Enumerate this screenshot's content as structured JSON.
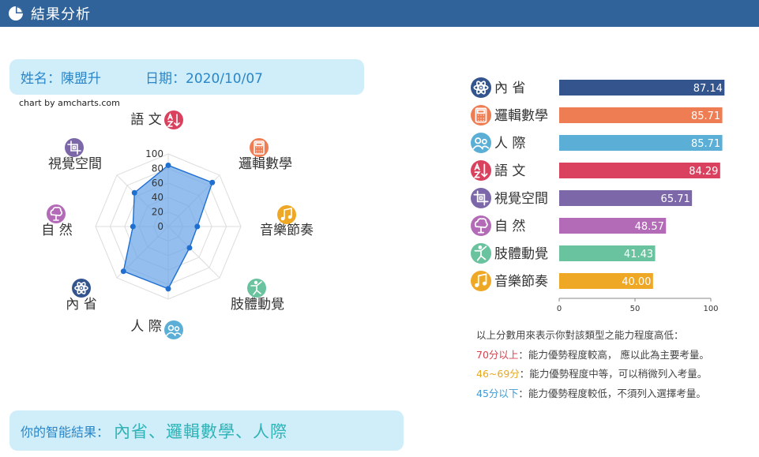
{
  "header": {
    "title": "結果分析"
  },
  "info": {
    "name": "姓名：陳盟升",
    "date": "日期：2020/10/07"
  },
  "credit": "chart by amcharts.com",
  "chart_data": [
    {
      "type": "radar",
      "axes": [
        "語 文",
        "邏輯數學",
        "音樂節奏",
        "肢體動覺",
        "人 際",
        "內 省",
        "自 然",
        "視覺空間"
      ],
      "icons": [
        "az-icon",
        "calculator-icon",
        "music-icon",
        "dance-icon",
        "people-icon",
        "atom-icon",
        "tree-icon",
        "crop-icon"
      ],
      "icon_colors": [
        "#d9415e",
        "#ef7d53",
        "#efa825",
        "#68c39e",
        "#5bafd7",
        "#33548d",
        "#b46bb7",
        "#7c67a9"
      ],
      "values": [
        84.29,
        85.71,
        40.0,
        41.43,
        85.71,
        87.14,
        48.57,
        65.71
      ],
      "ticks": [
        "0",
        "20",
        "40",
        "60",
        "80",
        "100"
      ],
      "range": [
        0,
        100
      ],
      "fill": "#6aa5e8",
      "stroke": "#1f6fd1"
    },
    {
      "type": "bar",
      "orientation": "horizontal",
      "categories": [
        "內 省",
        "邏輯數學",
        "人 際",
        "語 文",
        "視覺空間",
        "自 然",
        "肢體動覺",
        "音樂節奏"
      ],
      "values": [
        87.14,
        85.71,
        85.71,
        84.29,
        65.71,
        48.57,
        41.43,
        40.0
      ],
      "value_labels": [
        "87.14",
        "85.71",
        "85.71",
        "84.29",
        "65.71",
        "48.57",
        "41.43",
        "40.00"
      ],
      "colors": [
        "#33548d",
        "#ef7d53",
        "#5bafd7",
        "#d9415e",
        "#7c67a9",
        "#b46bb7",
        "#68c39e",
        "#efa825"
      ],
      "icons": [
        "atom-icon",
        "calculator-icon",
        "people-icon",
        "az-icon",
        "crop-icon",
        "tree-icon",
        "dance-icon",
        "music-icon"
      ],
      "ticks": [
        "0",
        "50",
        "100"
      ],
      "xlim": [
        0,
        100
      ]
    }
  ],
  "legend": {
    "intro": "以上分數用來表示你對該類型之能力程度高低：",
    "high_label": "70分以上",
    "high_text": "：能力優勢程度較高， 應以此為主要考量。",
    "mid_label": "46~69分",
    "mid_text": "：能力優勢程度中等，可以稍微列入考量。",
    "low_label": "45分以下",
    "low_text": "：能力優勢程度較低，不須列入選擇考量。"
  },
  "result": {
    "label": "你的智能結果：",
    "value": "內省、邏輯數學、人際"
  }
}
